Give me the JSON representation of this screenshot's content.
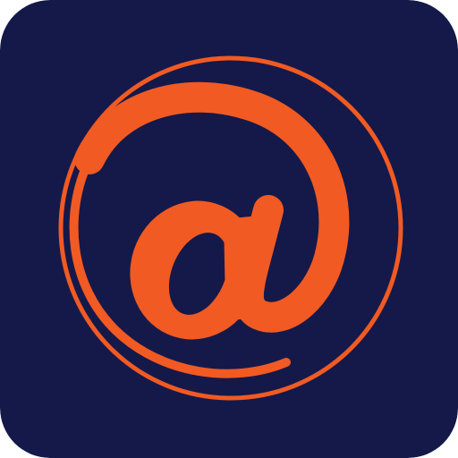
{
  "icon": {
    "name": "at-sign-icon",
    "glyph": "@",
    "colors": {
      "background": "#14194a",
      "accent": "#f15a22"
    }
  }
}
